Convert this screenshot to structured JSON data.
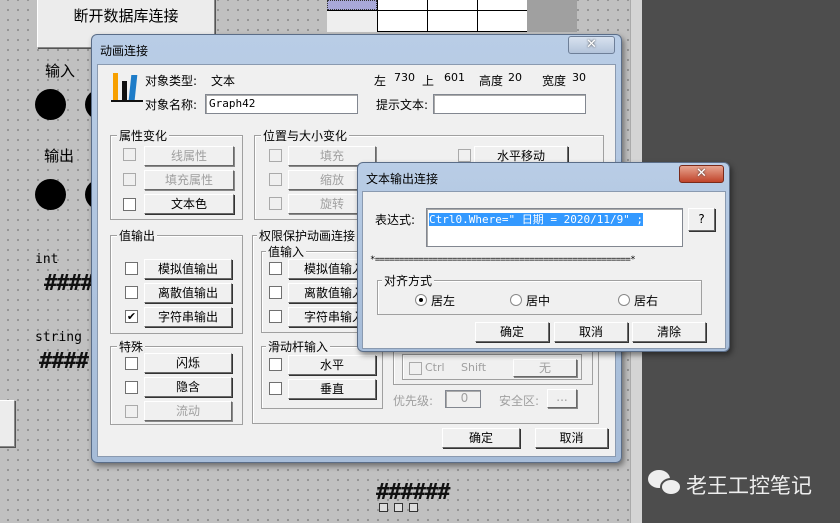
{
  "background": {
    "disconnect_button": "断开数据库连接",
    "input_label": "输入",
    "output_label": "输出",
    "int_label": "int",
    "string_label": "string",
    "hash_short": "####",
    "hash_long": "######"
  },
  "watermark": {
    "text": "老王工控笔记",
    "icon": "wechat-icon"
  },
  "anim_dialog": {
    "title": "动画连接",
    "object_type_label": "对象类型:",
    "object_type_value": "文本",
    "left_label": "左",
    "left_value": "730",
    "top_label": "上",
    "top_value": "601",
    "height_label": "高度",
    "height_value": "20",
    "width_label": "宽度",
    "width_value": "30",
    "object_name_label": "对象名称:",
    "object_name_value": "Graph42",
    "hint_label": "提示文本:",
    "hint_value": "",
    "attr_group": {
      "title": "属性变化",
      "items": [
        {
          "label": "线属性",
          "checked": false,
          "enabled": false
        },
        {
          "label": "填充属性",
          "checked": false,
          "enabled": false
        },
        {
          "label": "文本色",
          "checked": false,
          "enabled": true
        }
      ]
    },
    "pos_group": {
      "title": "位置与大小变化",
      "items": [
        {
          "label": "填充",
          "enabled": false
        },
        {
          "label": "缩放",
          "enabled": false
        },
        {
          "label": "旋转",
          "enabled": false
        }
      ],
      "hmove": "水平移动"
    },
    "value_out_group": {
      "title": "值输出",
      "items": [
        {
          "label": "模拟值输出",
          "checked": false
        },
        {
          "label": "离散值输出",
          "checked": false
        },
        {
          "label": "字符串输出",
          "checked": true
        }
      ]
    },
    "special_group": {
      "title": "特殊",
      "items": [
        {
          "label": "闪烁",
          "enabled": true
        },
        {
          "label": "隐含",
          "enabled": true
        },
        {
          "label": "流动",
          "enabled": false
        }
      ]
    },
    "perm_group": {
      "title": "权限保护动画连接",
      "value_in": {
        "title": "值输入",
        "items": [
          {
            "label": "模拟值输入"
          },
          {
            "label": "离散值输入"
          },
          {
            "label": "字符串输入"
          }
        ]
      },
      "slider": {
        "title": "滑动杆输入",
        "items": [
          {
            "label": "水平"
          },
          {
            "label": "垂直"
          }
        ]
      },
      "ctrl": "Ctrl",
      "shift": "Shift",
      "key": "无",
      "priority_label": "优先级:",
      "priority_value": "0",
      "security_label": "安全区:",
      "security_btn": "..."
    },
    "ok": "确定",
    "cancel": "取消"
  },
  "text_dialog": {
    "title": "文本输出连接",
    "expr_label": "表达式:",
    "expr_value": "Ctrl0.Where=\" 日期 = 2020/11/9\" ;",
    "help_btn": "?",
    "separator": "*=====================================================*",
    "align_group": {
      "title": "对齐方式",
      "options": [
        {
          "label": "居左",
          "selected": true
        },
        {
          "label": "居中",
          "selected": false
        },
        {
          "label": "居右",
          "selected": false
        }
      ]
    },
    "ok": "确定",
    "cancel": "取消",
    "clear": "清除"
  }
}
